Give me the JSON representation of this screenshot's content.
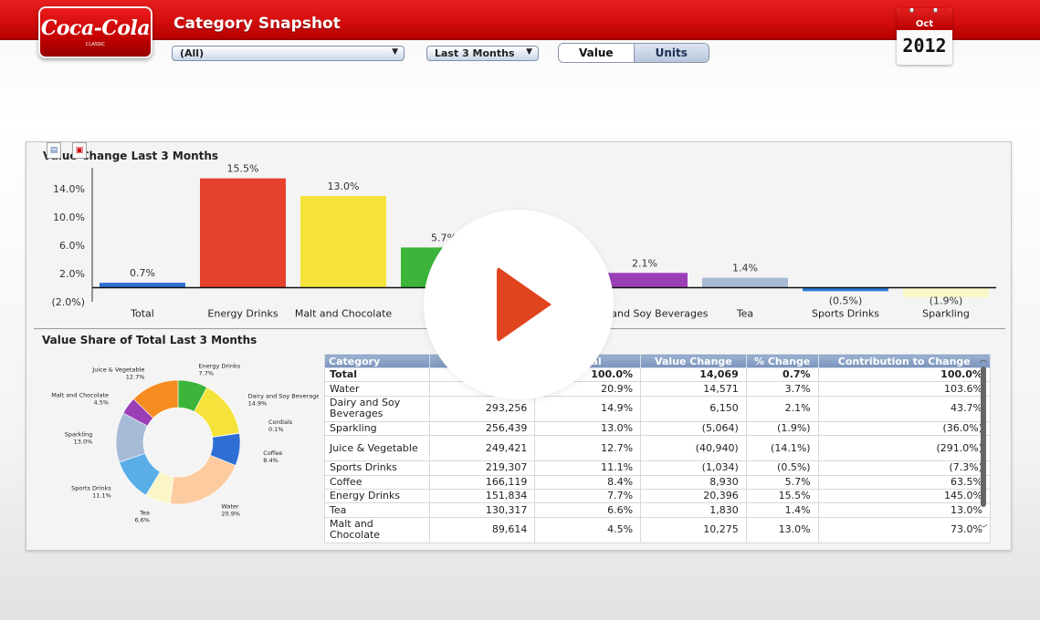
{
  "header": {
    "logo_text": "Coca-Cola",
    "logo_sub": "CLASSIC",
    "title": "Category Snapshot"
  },
  "filters": {
    "category": {
      "selected": "(All)"
    },
    "period": {
      "selected": "Last 3 Months"
    },
    "measure_toggle": {
      "value_label": "Value",
      "units_label": "Units",
      "active": "Value"
    }
  },
  "calendar": {
    "month": "Oct",
    "year": "2012"
  },
  "bar_panel": {
    "title": "Value Change Last 3 Months"
  },
  "pie_panel": {
    "title": "Value Share of Total Last 3 Months"
  },
  "chart_data": [
    {
      "type": "bar",
      "title": "Value Change Last 3 Months",
      "categories": [
        "Total",
        "Energy Drinks",
        "Malt and Chocolate",
        "Coffee",
        "Juice & Vegetable",
        "Dairy and Soy Beverages",
        "Tea",
        "Sports Drinks",
        "Sparkling"
      ],
      "values": [
        0.7,
        15.5,
        13.0,
        5.7,
        -14.1,
        2.1,
        1.4,
        -0.5,
        -1.9
      ],
      "value_labels": [
        "0.7%",
        "15.5%",
        "13.0%",
        "5.7%",
        "(14.1%)",
        "2.1%",
        "1.4%",
        "(0.5%)",
        "(1.9%)"
      ],
      "colors": [
        "#2f6fd4",
        "#e5412d",
        "#f5e33b",
        "#3cb53a",
        "#f58c1f",
        "#9b3fb7",
        "#a7bad6",
        "#2d7bd6",
        "#fbf6c8"
      ],
      "yticks": [
        "14.0%",
        "10.0%",
        "6.0%",
        "2.0%",
        "(2.0%)"
      ],
      "ytick_values": [
        14,
        10,
        6,
        2,
        -2
      ],
      "ylim": [
        -2,
        17
      ]
    },
    {
      "type": "pie",
      "title": "Value Share of Total Last 3 Months",
      "slices": [
        {
          "label": "Energy Drinks",
          "value_label": "7.7%",
          "value": 7.7,
          "color": "#3cb53a"
        },
        {
          "label": "Dairy and Soy Beverages",
          "value_label": "14.9%",
          "value": 14.9,
          "color": "#f5e33b"
        },
        {
          "label": "Cordials",
          "value_label": "0.1%",
          "value": 0.1,
          "color": "#c0392b"
        },
        {
          "label": "Coffee",
          "value_label": "8.4%",
          "value": 8.4,
          "color": "#2f6fd4"
        },
        {
          "label": "Water",
          "value_label": "20.9%",
          "value": 20.9,
          "color": "#fccca0"
        },
        {
          "label": "Tea",
          "value_label": "6.6%",
          "value": 6.6,
          "color": "#fbf6c8"
        },
        {
          "label": "Sports Drinks",
          "value_label": "11.1%",
          "value": 11.1,
          "color": "#5aaee8"
        },
        {
          "label": "Sparkling",
          "value_label": "13.0%",
          "value": 13.0,
          "color": "#a7bad6"
        },
        {
          "label": "Malt and Chocolate",
          "value_label": "4.5%",
          "value": 4.5,
          "color": "#9b3fb7"
        },
        {
          "label": "Juice & Vegetable",
          "value_label": "12.7%",
          "value": 12.7,
          "color": "#f58c1f"
        }
      ]
    }
  ],
  "table": {
    "columns": [
      "Category",
      "",
      "Total",
      "Value Change",
      "% Change",
      "Contribution to Change"
    ],
    "rows": [
      [
        "Total",
        "",
        "100.0%",
        "14,069",
        "0.7%",
        "100.0%"
      ],
      [
        "Water",
        "",
        "20.9%",
        "14,571",
        "3.7%",
        "103.6%"
      ],
      [
        "Dairy and Soy Beverages",
        "293,256",
        "14.9%",
        "6,150",
        "2.1%",
        "43.7%"
      ],
      [
        "Sparkling",
        "256,439",
        "13.0%",
        "(5,064)",
        "(1.9%)",
        "(36.0%)"
      ],
      [
        "Juice & Vegetable",
        "249,421",
        "12.7%",
        "(40,940)",
        "(14.1%)",
        "(291.0%)"
      ],
      [
        "Sports Drinks",
        "219,307",
        "11.1%",
        "(1,034)",
        "(0.5%)",
        "(7.3%)"
      ],
      [
        "Coffee",
        "166,119",
        "8.4%",
        "8,930",
        "5.7%",
        "63.5%"
      ],
      [
        "Energy Drinks",
        "151,834",
        "7.7%",
        "20,396",
        "15.5%",
        "145.0%"
      ],
      [
        "Tea",
        "130,317",
        "6.6%",
        "1,830",
        "1.4%",
        "13.0%"
      ],
      [
        "Malt and Chocolate",
        "89,614",
        "4.5%",
        "10,275",
        "13.0%",
        "73.0%"
      ]
    ]
  },
  "icons": {
    "export": "export-icon",
    "pdf": "pdf-icon",
    "play": "play-icon",
    "dropdown": "chevron-down-icon"
  }
}
